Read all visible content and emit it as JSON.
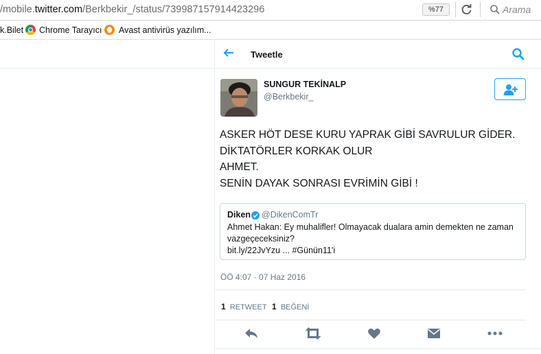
{
  "browser": {
    "url_prefix": "/mobile.",
    "url_host": "twitter.com",
    "url_path": "/Berkbekir_/status/739987157914423296",
    "zoom": "%77",
    "search_placeholder": "Arama"
  },
  "bookmarks": [
    {
      "label": "k.Bilet"
    },
    {
      "label": "Chrome Tarayıcı"
    },
    {
      "label": "Avast antivirüs yazılım..."
    }
  ],
  "header": {
    "title": "Tweetle"
  },
  "tweet": {
    "name": "SUNGUR TEKİNALP",
    "handle": "@Berkbekir_",
    "lines": [
      "ASKER HÖT DESE KURU YAPRAK GİBİ SAVRULUR GİDER.",
      "DİKTATÖRLER KORKAK OLUR",
      "AHMET.",
      "SENİN DAYAK SONRASI EVRİMİN GİBİ !"
    ],
    "timestamp": "ÖÖ 4:07 · 07 Haz 2016",
    "retweet_count": "1",
    "retweet_label": "RETWEET",
    "like_count": "1",
    "like_label": "BEĞENİ"
  },
  "quote": {
    "name": "Diken",
    "handle": "@DikenComTr",
    "text_line1": "Ahmet Hakan: Ey muhalifler! Olmayacak dualara amin demekten ne zaman",
    "text_line2": "vazgeçeceksiniz?",
    "text_line3": "bit.ly/22JvYzu ... #Günün11'i"
  },
  "colors": {
    "twitter_blue": "#1da1f2",
    "action_grey": "#657786"
  }
}
